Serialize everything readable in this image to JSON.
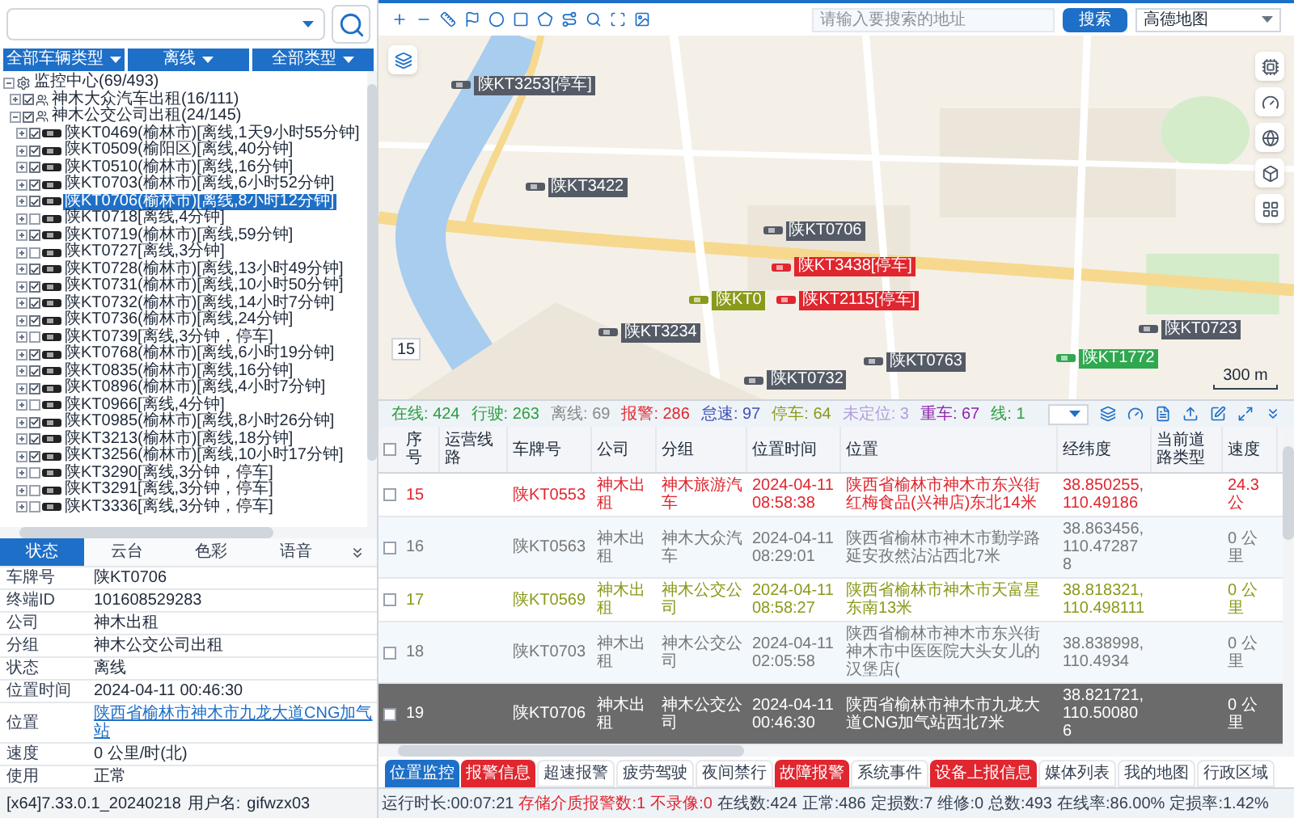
{
  "left_panel": {
    "filters": [
      "全部车辆类型",
      "离线",
      "全部类型"
    ],
    "tree": [
      {
        "kind": "root",
        "label": "监控中心(69/493)",
        "selected": false,
        "children": [
          {
            "kind": "group",
            "label": "神木大众汽车出租(16/111)",
            "checked": true,
            "selected": false
          },
          {
            "kind": "group",
            "label": "神木公交公司出租(24/145)",
            "checked": true,
            "selected": false,
            "children": [
              {
                "kind": "vehicle",
                "label": "陕KT0469(榆林市)[离线,1天9小时55分钟]",
                "checked": true,
                "selected": false
              },
              {
                "kind": "vehicle",
                "label": "陕KT0509(榆阳区)[离线,40分钟]",
                "checked": true,
                "selected": false
              },
              {
                "kind": "vehicle",
                "label": "陕KT0510(榆林市)[离线,16分钟]",
                "checked": true,
                "selected": false
              },
              {
                "kind": "vehicle",
                "label": "陕KT0703(榆林市)[离线,6小时52分钟]",
                "checked": true,
                "selected": false
              },
              {
                "kind": "vehicle",
                "label": "陕KT0706(榆林市)[离线,8小时12分钟]",
                "checked": true,
                "selected": true
              },
              {
                "kind": "vehicle",
                "label": "陕KT0718[离线,4分钟]",
                "checked": false,
                "selected": false
              },
              {
                "kind": "vehicle",
                "label": "陕KT0719(榆林市)[离线,59分钟]",
                "checked": true,
                "selected": false
              },
              {
                "kind": "vehicle",
                "label": "陕KT0727[离线,3分钟]",
                "checked": false,
                "selected": false
              },
              {
                "kind": "vehicle",
                "label": "陕KT0728(榆林市)[离线,13小时49分钟]",
                "checked": true,
                "selected": false
              },
              {
                "kind": "vehicle",
                "label": "陕KT0731(榆林市)[离线,10小时50分钟]",
                "checked": true,
                "selected": false
              },
              {
                "kind": "vehicle",
                "label": "陕KT0732(榆林市)[离线,14小时7分钟]",
                "checked": true,
                "selected": false
              },
              {
                "kind": "vehicle",
                "label": "陕KT0736(榆林市)[离线,24分钟]",
                "checked": true,
                "selected": false
              },
              {
                "kind": "vehicle",
                "label": "陕KT0739[离线,3分钟，停车]",
                "checked": false,
                "selected": false
              },
              {
                "kind": "vehicle",
                "label": "陕KT0768(榆林市)[离线,6小时19分钟]",
                "checked": true,
                "selected": false
              },
              {
                "kind": "vehicle",
                "label": "陕KT0835(榆林市)[离线,16分钟]",
                "checked": true,
                "selected": false
              },
              {
                "kind": "vehicle",
                "label": "陕KT0896(榆林市)[离线,4小时7分钟]",
                "checked": true,
                "selected": false
              },
              {
                "kind": "vehicle",
                "label": "陕KT0966[离线,4分钟]",
                "checked": false,
                "selected": false
              },
              {
                "kind": "vehicle",
                "label": "陕KT0985(榆林市)[离线,8小时26分钟]",
                "checked": true,
                "selected": false
              },
              {
                "kind": "vehicle",
                "label": "陕KT3213(榆林市)[离线,18分钟]",
                "checked": true,
                "selected": false
              },
              {
                "kind": "vehicle",
                "label": "陕KT3256(榆林市)[离线,10小时17分钟]",
                "checked": true,
                "selected": false
              },
              {
                "kind": "vehicle",
                "label": "陕KT3290[离线,3分钟，停车]",
                "checked": false,
                "selected": false
              },
              {
                "kind": "vehicle",
                "label": "陕KT3291[离线,3分钟，停车]",
                "checked": false,
                "selected": false
              },
              {
                "kind": "vehicle",
                "label": "陕KT3336[离线,3分钟，停车]",
                "checked": false,
                "selected": false
              }
            ]
          }
        ]
      }
    ],
    "detail_tabs": [
      {
        "label": "状态",
        "selected": true
      },
      {
        "label": "云台",
        "selected": false
      },
      {
        "label": "色彩",
        "selected": false
      },
      {
        "label": "语音",
        "selected": false
      }
    ],
    "details": [
      {
        "label": "车牌号",
        "value": "陕KT0706",
        "kind": "text"
      },
      {
        "label": "终端ID",
        "value": "101608529283",
        "kind": "text"
      },
      {
        "label": "公司",
        "value": "神木出租",
        "kind": "text"
      },
      {
        "label": "分组",
        "value": "神木公交公司出租",
        "kind": "text"
      },
      {
        "label": "状态",
        "value": "离线",
        "kind": "text"
      },
      {
        "label": "位置时间",
        "value": "2024-04-11 00:46:30",
        "kind": "text"
      },
      {
        "label": "位置",
        "value": "陕西省榆林市神木市九龙大道CNG加气站",
        "kind": "link"
      },
      {
        "label": "速度",
        "value": "0 公里/时(北)",
        "kind": "text"
      },
      {
        "label": "使用",
        "value": "正常",
        "kind": "text"
      }
    ],
    "version": "[x64]7.33.0.1_20240218",
    "user_label": "用户名:",
    "user": "gifwzx03"
  },
  "map_toolbar": {
    "search": {
      "placeholder": "请输入要搜索的地址"
    },
    "search_button": "搜索",
    "map_type": "高德地图"
  },
  "map": {
    "zoom": "15",
    "scale": "300 m",
    "markers": [
      {
        "label": "陕KT3253[停车]",
        "color": "#555b66"
      },
      {
        "label": "陕KT3422",
        "color": "#555b66"
      },
      {
        "label": "陕KT0706",
        "color": "#555b66"
      },
      {
        "label": "陕KT3438[停车]",
        "color": "#e0262e"
      },
      {
        "label": "陕KT0",
        "color": "#8a9a1a"
      },
      {
        "label": "陕KT2115[停车]",
        "color": "#e0262e"
      },
      {
        "label": "陕KT3234",
        "color": "#555b66"
      },
      {
        "label": "陕KT0763",
        "color": "#555b66"
      },
      {
        "label": "陕KT0732",
        "color": "#555b66"
      },
      {
        "label": "陕KT0723",
        "color": "#555b66"
      },
      {
        "label": "陕KT1772",
        "color": "#2fa84f"
      }
    ]
  },
  "stats": [
    {
      "label": "在线:",
      "value": "424",
      "color": "#2f9e3f"
    },
    {
      "label": "行驶:",
      "value": "263",
      "color": "#2f9e3f"
    },
    {
      "label": "离线:",
      "value": "69",
      "color": "#888888"
    },
    {
      "label": "报警:",
      "value": "286",
      "color": "#e0262e"
    },
    {
      "label": "怠速:",
      "value": "97",
      "color": "#3f51b5"
    },
    {
      "label": "停车:",
      "value": "64",
      "color": "#8a9a1a"
    },
    {
      "label": "未定位:",
      "value": "3",
      "color": "#b39ddb"
    },
    {
      "label": "重车:",
      "value": "67",
      "color": "#8e24aa"
    },
    {
      "label": "线:",
      "value": "1",
      "color": "#2f9e3f"
    }
  ],
  "table": {
    "all_checked": false,
    "columns": [
      "序号",
      "运营线路",
      "车牌号",
      "公司",
      "分组",
      "位置时间",
      "位置",
      "经纬度",
      "当前道路类型",
      "速度"
    ],
    "rows": [
      {
        "checked": false,
        "selected": false,
        "color": "#e0262e",
        "cells": [
          "15",
          "",
          "陕KT0553",
          "神木出租",
          "神木旅游汽车",
          "2024-04-11 08:58:38",
          "陕西省榆林市神木市东兴街红梅食品(兴神店)东北14米",
          "38.850255,110.49186",
          "",
          "24.3 公"
        ]
      },
      {
        "checked": false,
        "selected": false,
        "color": "#777777",
        "cells": [
          "16",
          "",
          "陕KT0563",
          "神木出租",
          "神木大众汽车",
          "2024-04-11 08:29:01",
          "陕西省榆林市神木市勤学路延安孜然沾沾西北7米",
          "38.863456,110.472878",
          "",
          "0 公里"
        ]
      },
      {
        "checked": false,
        "selected": false,
        "color": "#8a9a1a",
        "cells": [
          "17",
          "",
          "陕KT0569",
          "神木出租",
          "神木公交公司",
          "2024-04-11 08:58:27",
          "陕西省榆林市神木市天富星东南13米",
          "38.818321,110.498111",
          "",
          "0 公里"
        ]
      },
      {
        "checked": false,
        "selected": false,
        "color": "#777777",
        "cells": [
          "18",
          "",
          "陕KT0703",
          "神木出租",
          "神木公交公司",
          "2024-04-11 02:05:58",
          "陕西省榆林市神木市东兴街神木市中医医院大头女儿的汉堡店(",
          "38.838998,110.4934",
          "",
          "0 公里"
        ]
      },
      {
        "checked": false,
        "selected": true,
        "cells": [
          "19",
          "",
          "陕KT0706",
          "神木出租",
          "神木公交公司",
          "2024-04-11 00:46:30",
          "陕西省榆林市神木市九龙大道CNG加气站西北7米",
          "38.821721,110.500806",
          "",
          "0 公里"
        ]
      }
    ]
  },
  "bottom_tabs": [
    {
      "label": "位置监控",
      "kind": "normal",
      "selected": true
    },
    {
      "label": "报警信息",
      "kind": "alarm",
      "selected": false
    },
    {
      "label": "超速报警",
      "kind": "normal",
      "selected": false
    },
    {
      "label": "疲劳驾驶",
      "kind": "normal",
      "selected": false
    },
    {
      "label": "夜间禁行",
      "kind": "normal",
      "selected": false
    },
    {
      "label": "故障报警",
      "kind": "alarm",
      "selected": false
    },
    {
      "label": "系统事件",
      "kind": "normal",
      "selected": false
    },
    {
      "label": "设备上报信息",
      "kind": "alarm",
      "selected": false
    },
    {
      "label": "媒体列表",
      "kind": "normal",
      "selected": false
    },
    {
      "label": "我的地图",
      "kind": "normal",
      "selected": false
    },
    {
      "label": "行政区域",
      "kind": "normal",
      "selected": false
    }
  ],
  "status_bar": [
    {
      "label": "运行时长:",
      "value": "00:07:21",
      "kind": "normal"
    },
    {
      "label": "存储介质报警数:",
      "value": "1",
      "kind": "alarm"
    },
    {
      "label": "不录像:",
      "value": "0",
      "kind": "alarm"
    },
    {
      "label": "在线数:",
      "value": "424",
      "kind": "normal"
    },
    {
      "label": "正常:",
      "value": "486",
      "kind": "normal"
    },
    {
      "label": "定损数:",
      "value": "7",
      "kind": "normal"
    },
    {
      "label": "维修:",
      "value": "0",
      "kind": "normal"
    },
    {
      "label": "总数:",
      "value": "493",
      "kind": "normal"
    },
    {
      "label": "在线率:",
      "value": "86.00%",
      "kind": "normal"
    },
    {
      "label": "定损率:",
      "value": "1.42%",
      "kind": "normal"
    }
  ]
}
